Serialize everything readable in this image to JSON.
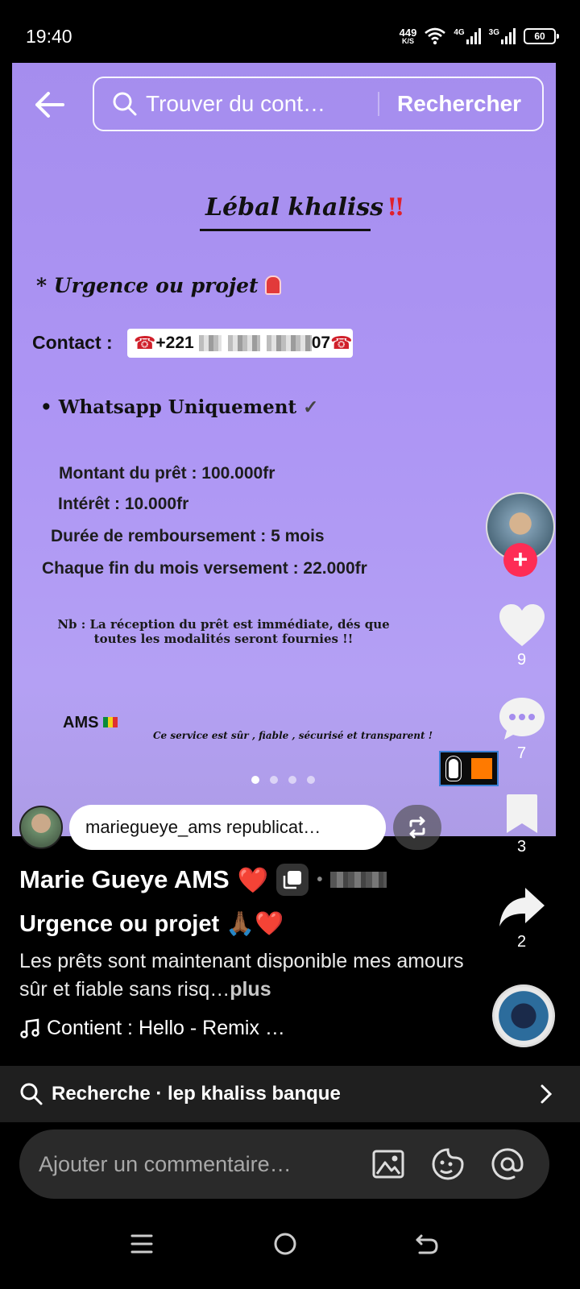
{
  "status_bar": {
    "time": "19:40",
    "net_speed_value": "449",
    "net_speed_unit": "K/S",
    "network_1": "4G",
    "network_2": "3G",
    "battery": "60"
  },
  "top_search": {
    "placeholder": "Trouver du cont…",
    "button_label": "Rechercher"
  },
  "poster": {
    "title": "Lébal khaliss",
    "title_mark": "‼",
    "urgence": "* Urgence ou projet",
    "contact_label": "Contact :",
    "phone_prefix": "+221",
    "phone_suffix": "07",
    "whatsapp": "• Whatsapp Uniquement",
    "whatsapp_mark": "✓",
    "montant": "Montant du prêt : 100.000fr",
    "interet": "Intérêt : 10.000fr",
    "duree": "Durée de remboursement : 5 mois",
    "versement": "Chaque fin du mois versement : 22.000fr",
    "nb": "Nb : La réception du prêt est immédiate, dés que toutes les modalités seront fournies !!",
    "ams": "AMS",
    "service": "Ce service est sûr , fiable , sécurisé et transparent !"
  },
  "carousel": {
    "count": 4,
    "active": 0
  },
  "repost": {
    "text": "mariegueye_ams republicat…"
  },
  "actions": {
    "likes": "9",
    "comments": "7",
    "saves": "3",
    "shares": "2"
  },
  "post": {
    "author": "Marie Gueye AMS",
    "author_emoji": "❤️",
    "caption_title": "Urgence ou projet",
    "caption_title_emoji": "🙏🏾❤️",
    "caption_body": "Les prêts sont maintenant disponible mes amours sûr et fiable sans risq…",
    "more_label": "plus",
    "music": "Contient : Hello - Remix …"
  },
  "related_search": {
    "label": "Recherche · lep khaliss banque"
  },
  "comment_input": {
    "placeholder": "Ajouter un commentaire…"
  },
  "colors": {
    "accent": "#fe2c55",
    "poster_bg": "#ad95f4",
    "heart_red": "#e0202a"
  },
  "icons": [
    "back-arrow-icon",
    "search-icon",
    "repost-icon",
    "heart-icon",
    "comment-icon",
    "bookmark-icon",
    "share-icon",
    "music-note-icon",
    "chevron-right-icon",
    "image-icon",
    "sticker-icon",
    "at-icon",
    "menu-icon",
    "home-circle-icon",
    "back-nav-icon"
  ]
}
